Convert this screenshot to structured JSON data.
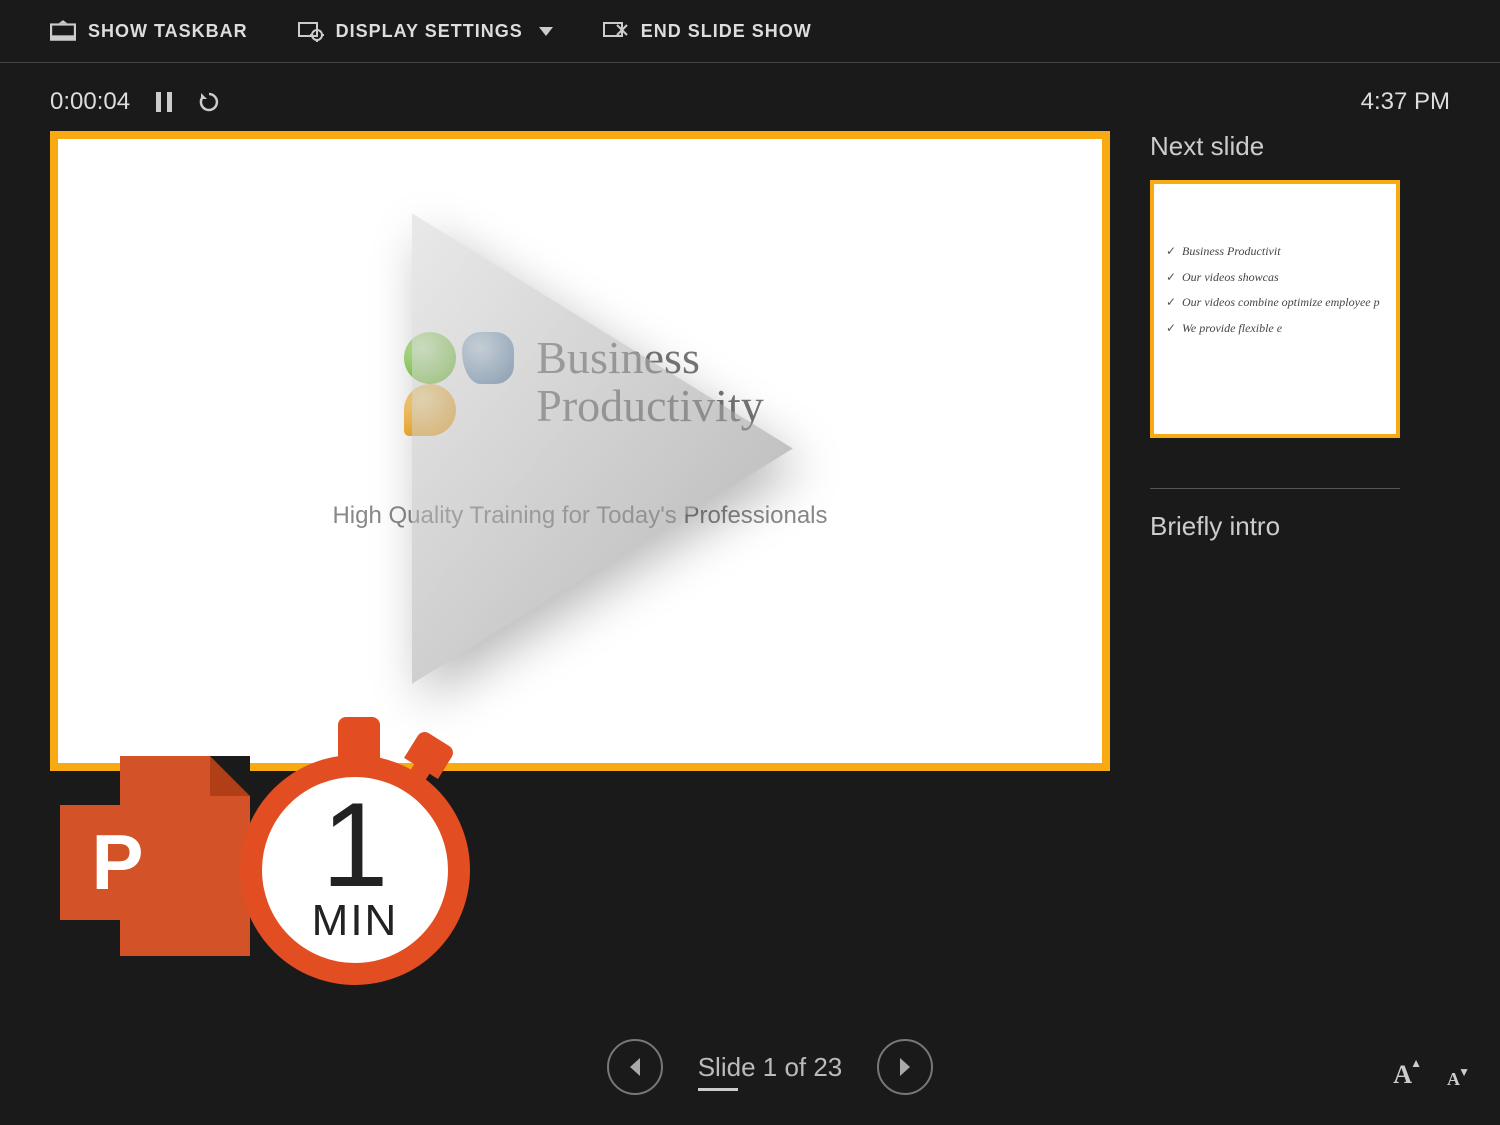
{
  "toolbar": {
    "show_taskbar": "SHOW TASKBAR",
    "display_settings": "DISPLAY SETTINGS",
    "end_slide_show": "END SLIDE SHOW"
  },
  "timer": {
    "elapsed": "0:00:04"
  },
  "clock": {
    "time": "4:37 PM"
  },
  "current_slide": {
    "logo_line1": "Business",
    "logo_line2": "Productivity",
    "tagline": "High Quality Training for Today's Professionals"
  },
  "next": {
    "label": "Next slide",
    "bullets": [
      "Business Productivit",
      "Our videos showcas",
      "Our videos combine optimize employee p",
      "We provide flexible e"
    ]
  },
  "notes": {
    "text": "Briefly intro"
  },
  "nav": {
    "counter": "Slide 1 of 23"
  },
  "font_buttons": {
    "bigger": "A",
    "bigger_sup": "▲",
    "smaller": "A",
    "smaller_sup": "▼"
  },
  "badge": {
    "app_letter": "P",
    "count": "1",
    "unit": "MIN"
  }
}
